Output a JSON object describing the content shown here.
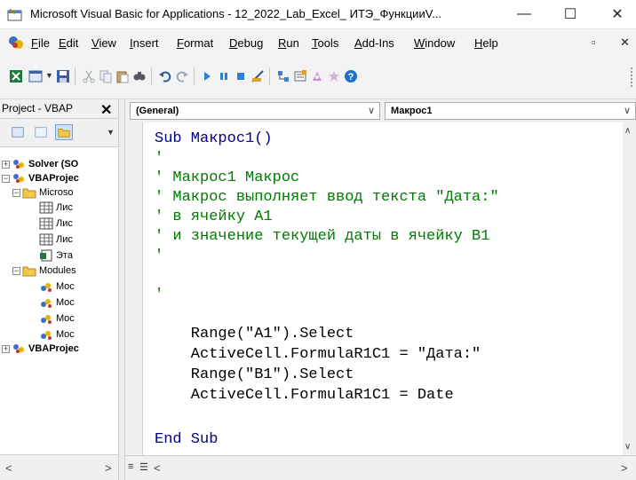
{
  "window": {
    "title": "Microsoft Visual Basic for Applications - 12_2022_Lab_Excel_ ИТЭ_ФункцииV...",
    "minimize": "—",
    "maximize": "☐",
    "close": "✕"
  },
  "menu": {
    "items": [
      "File",
      "Edit",
      "View",
      "Insert",
      "Format",
      "Debug",
      "Run",
      "Tools",
      "Add-Ins",
      "Window",
      "Help"
    ],
    "mdi_restore": "▫",
    "mdi_close": "✕"
  },
  "project": {
    "title": "Project - VBAP",
    "close": "✕",
    "tree": [
      {
        "label": "Solver (SO",
        "bold": true,
        "toggle": "+",
        "icon": "vbaproject-icon"
      },
      {
        "label": "VBAProjec",
        "bold": true,
        "toggle": "−",
        "icon": "vbaproject-icon"
      },
      {
        "label": "Microso",
        "bold": false,
        "toggle": "−",
        "icon": "folder-icon"
      },
      {
        "label": "Лис",
        "bold": false,
        "toggle": "",
        "icon": "sheet-icon"
      },
      {
        "label": "Лис",
        "bold": false,
        "toggle": "",
        "icon": "sheet-icon"
      },
      {
        "label": "Лис",
        "bold": false,
        "toggle": "",
        "icon": "sheet-icon"
      },
      {
        "label": "Эта",
        "bold": false,
        "toggle": "",
        "icon": "workbook-icon"
      },
      {
        "label": "Modules",
        "bold": false,
        "toggle": "−",
        "icon": "folder-icon"
      },
      {
        "label": "Moc",
        "bold": false,
        "toggle": "",
        "icon": "module-icon"
      },
      {
        "label": "Moc",
        "bold": false,
        "toggle": "",
        "icon": "module-icon"
      },
      {
        "label": "Moc",
        "bold": false,
        "toggle": "",
        "icon": "module-icon"
      },
      {
        "label": "Moc",
        "bold": false,
        "toggle": "",
        "icon": "module-icon"
      },
      {
        "label": "VBAProjec",
        "bold": true,
        "toggle": "+",
        "icon": "vbaproject-icon"
      }
    ]
  },
  "code": {
    "object_combo": "(General)",
    "procedure_combo": "Макрос1",
    "lines": [
      {
        "text": "Sub Макрос1()",
        "kind": "kw"
      },
      {
        "text": "'",
        "kind": "cmt"
      },
      {
        "text": "' Макрос1 Макрос",
        "kind": "cmt"
      },
      {
        "text": "' Макрос выполняет ввод текста \"Дата:\"",
        "kind": "cmt"
      },
      {
        "text": "' в ячейку A1",
        "kind": "cmt"
      },
      {
        "text": "' и значение текущей даты в ячейку B1",
        "kind": "cmt"
      },
      {
        "text": "'",
        "kind": "cmt"
      },
      {
        "text": "",
        "kind": "plain"
      },
      {
        "text": "'",
        "kind": "cmt"
      },
      {
        "text": "",
        "kind": "plain"
      },
      {
        "text": "    Range(\"A1\").Select",
        "kind": "plain"
      },
      {
        "text": "    ActiveCell.FormulaR1C1 = \"Дата:\"",
        "kind": "plain"
      },
      {
        "text": "    Range(\"B1\").Select",
        "kind": "plain"
      },
      {
        "text": "    ActiveCell.FormulaR1C1 = Date",
        "kind": "plain"
      },
      {
        "text": "",
        "kind": "plain"
      },
      {
        "text": "End Sub",
        "kind": "kw"
      }
    ]
  },
  "icons": {
    "toolbar": [
      "excel-view-icon",
      "insert-userform-icon",
      "save-icon",
      "cut-icon",
      "copy-icon",
      "paste-icon",
      "find-icon",
      "undo-icon",
      "redo-icon",
      "run-icon",
      "break-icon",
      "reset-icon",
      "design-mode-icon",
      "project-explorer-icon",
      "properties-icon",
      "object-browser-icon",
      "toolbox-icon",
      "help-icon"
    ]
  },
  "colors": {
    "keyword": "#000088",
    "comment": "#007a00"
  }
}
